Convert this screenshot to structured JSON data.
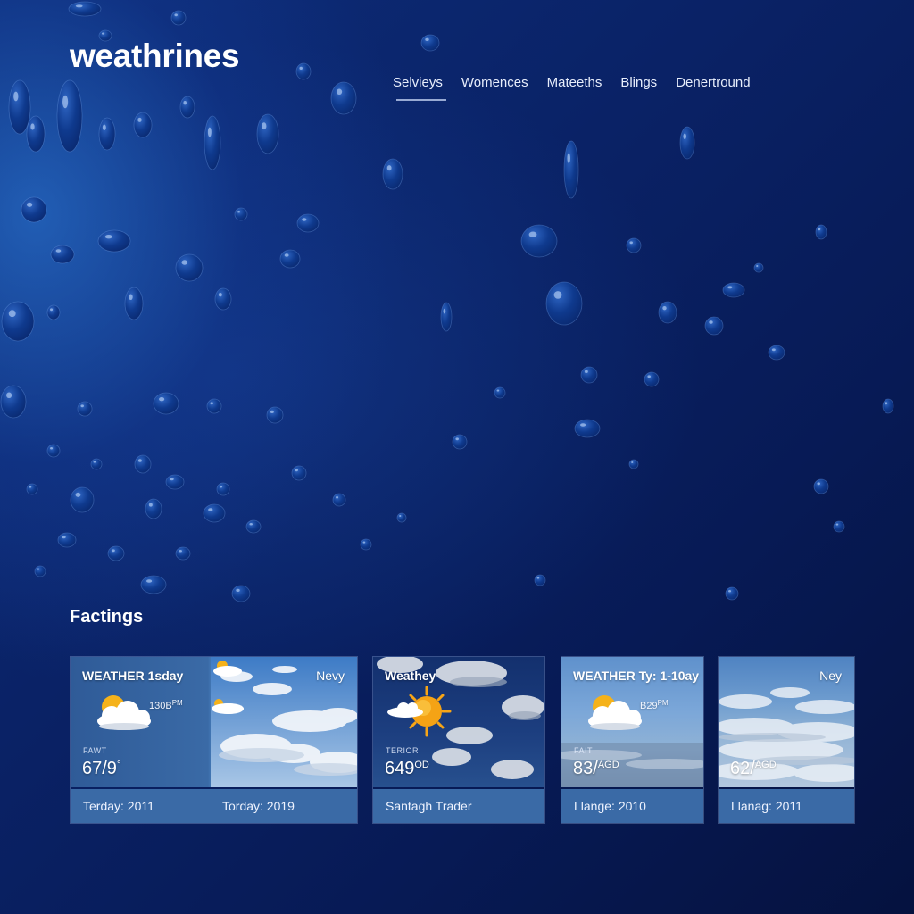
{
  "app": {
    "brand": "weathrines"
  },
  "nav": {
    "items": [
      {
        "label": "Selvieys",
        "active": true
      },
      {
        "label": "Womences",
        "active": false
      },
      {
        "label": "Mateeths",
        "active": false
      },
      {
        "label": "Blings",
        "active": false
      },
      {
        "label": "Denertround",
        "active": false
      }
    ]
  },
  "section": {
    "title": "Factings"
  },
  "cards": [
    {
      "title": "WEATHER 1sday",
      "tag": "Nevy",
      "time": "130B",
      "time_suffix": "PM",
      "label": "FAWT",
      "temp": "67/9",
      "temp_unit": "°",
      "footer": [
        "Terday: 2011",
        "Torday: 2019"
      ],
      "icon": "partly-cloudy-icon"
    },
    {
      "title": "Weathey",
      "label": "TERIOR",
      "temp": "649",
      "temp_unit": "OD",
      "footer": [
        "Santagh Trader"
      ],
      "icon": "sun-cloud-icon"
    },
    {
      "title": "WEATHER Ty: 1-10ay",
      "time": "B29",
      "time_suffix": "PM",
      "label": "FAIT",
      "temp": "83/",
      "temp_unit": "AGD",
      "footer": [
        "Llange: 2010"
      ],
      "icon": "partly-cloudy-icon"
    },
    {
      "tag": "Ney",
      "temp": "62/",
      "temp_unit": "AGD",
      "footer": [
        "Llanag: 2011"
      ],
      "icon": "cloud-layer-icon"
    }
  ],
  "colors": {
    "background": "#0a2266",
    "card_footer": "#3a6aa6",
    "sun": "#f5b21a",
    "text": "#ffffff"
  }
}
